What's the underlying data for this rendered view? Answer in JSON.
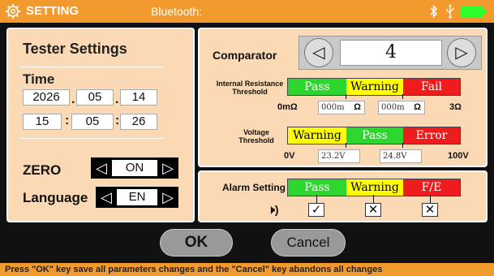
{
  "header": {
    "title": "SETTING",
    "bluetooth_label": "Bluetooth:",
    "gear_icon": "gear-icon",
    "bt_icon": "bluetooth-icon",
    "usb_icon": "usb-icon",
    "battery_color": "#2dff2d",
    "bar_color": "#f29a2e"
  },
  "tester": {
    "title": "Tester Settings",
    "time_label": "Time",
    "date": {
      "year": "2026",
      "month": "05",
      "day": "14"
    },
    "clock": {
      "hour": "15",
      "minute": "05",
      "second": "26"
    },
    "sep_dot": ".",
    "sep_colon": ":",
    "zero_label": "ZERO",
    "zero_value": "ON",
    "language_label": "Language",
    "language_value": "EN",
    "arrow_left": "◁",
    "arrow_right": "▷"
  },
  "comparator": {
    "label": "Comparator",
    "value": "4",
    "prev": "◁",
    "next": "▷"
  },
  "resistance": {
    "label_line1": "Internal Resistance",
    "label_line2": "Threshold",
    "pass": "Pass",
    "warning": "Warning",
    "fail": "Fail",
    "min": "0mΩ",
    "max": "3Ω",
    "low_value": "000m",
    "high_value": "000m",
    "unit": "Ω"
  },
  "voltage": {
    "label_line1": "Voltage",
    "label_line2": "Threshold",
    "warning": "Warning",
    "pass": "Pass",
    "error": "Error",
    "min": "0V",
    "max": "100V",
    "low_value": "23.2V",
    "high_value": "24.8V"
  },
  "alarm": {
    "label": "Alarm Setting",
    "pass": "Pass",
    "warning": "Warning",
    "fe": "F/E",
    "speaker_icon": "speaker-icon",
    "speaker_glyph": "🕨)",
    "pass_check": "✓",
    "warning_check": "✕",
    "fe_check": "✕"
  },
  "actions": {
    "ok": "OK",
    "cancel": "Cancel"
  },
  "footer": {
    "hint": "Press \"OK\" key save all parameters changes and the \"Cancel\" key abandons all changes"
  },
  "colors": {
    "pass": "#2dd62d",
    "warning": "#ffff00",
    "fail": "#ee1c1c",
    "panel": "#fbd9b4"
  }
}
